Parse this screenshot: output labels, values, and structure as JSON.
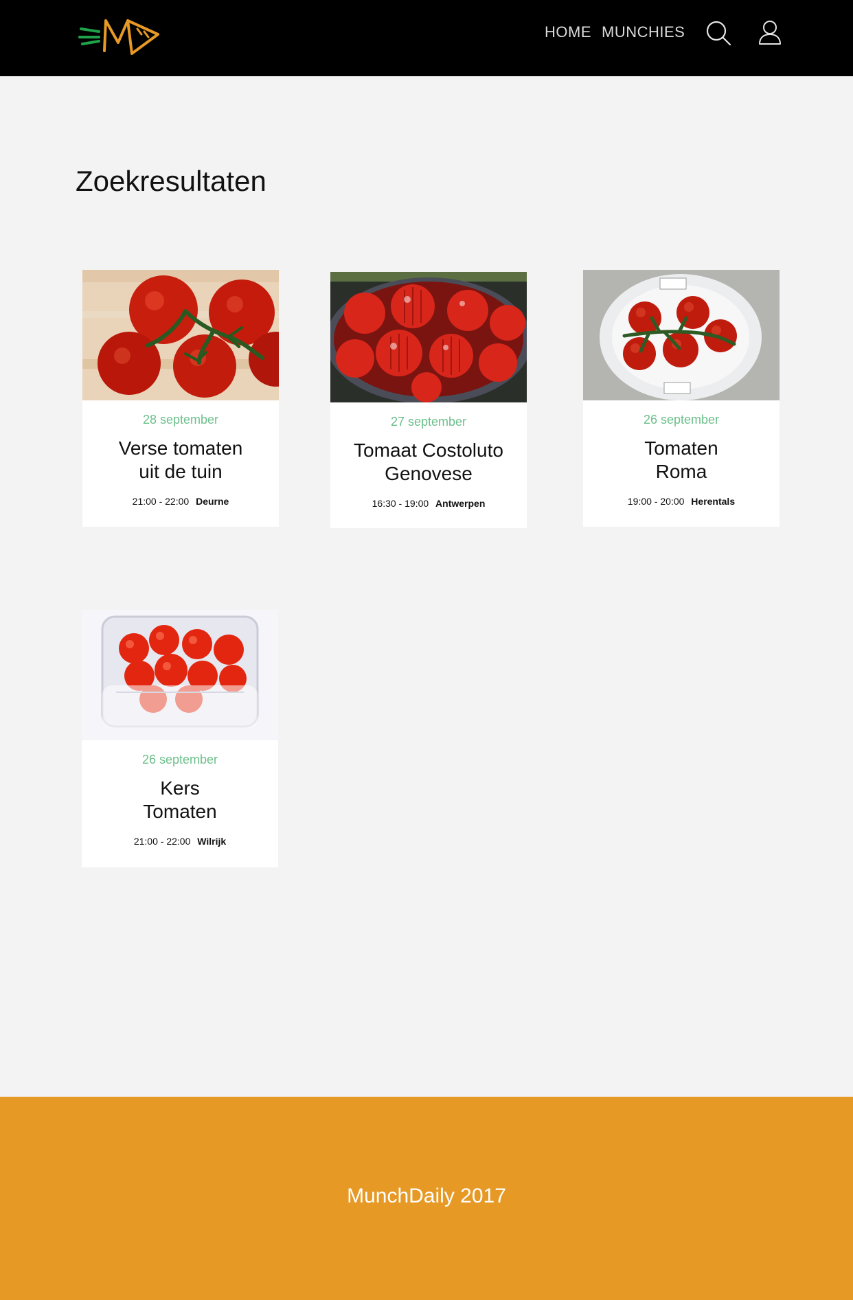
{
  "header": {
    "logo_icon": "munchdaily-logo",
    "nav": [
      {
        "label": "HOME"
      },
      {
        "label": "MUNCHIES"
      }
    ],
    "search_icon": "search-icon",
    "user_icon": "user-icon"
  },
  "main": {
    "title": "Zoekresultaten",
    "results": [
      {
        "date": "28 september",
        "title_line1": "Verse tomaten",
        "title_line2": "uit de tuin",
        "time": "21:00 - 22:00",
        "place": "Deurne"
      },
      {
        "date": "27 september",
        "title_line1": "Tomaat Costoluto",
        "title_line2": "Genovese",
        "time": "16:30 - 19:00",
        "place": "Antwerpen"
      },
      {
        "date": "26 september",
        "title_line1": "Tomaten",
        "title_line2": "Roma",
        "time": "19:00 - 20:00",
        "place": "Herentals"
      },
      {
        "date": "26 september",
        "title_line1": "Kers",
        "title_line2": "Tomaten",
        "time": "21:00 - 22:00",
        "place": "Wilrijk"
      }
    ]
  },
  "footer": {
    "text": "MunchDaily 2017"
  },
  "colors": {
    "header_bg": "#000000",
    "accent_orange": "#e69925",
    "date_green": "#6bbf8a",
    "page_bg": "#f3f3f3"
  }
}
